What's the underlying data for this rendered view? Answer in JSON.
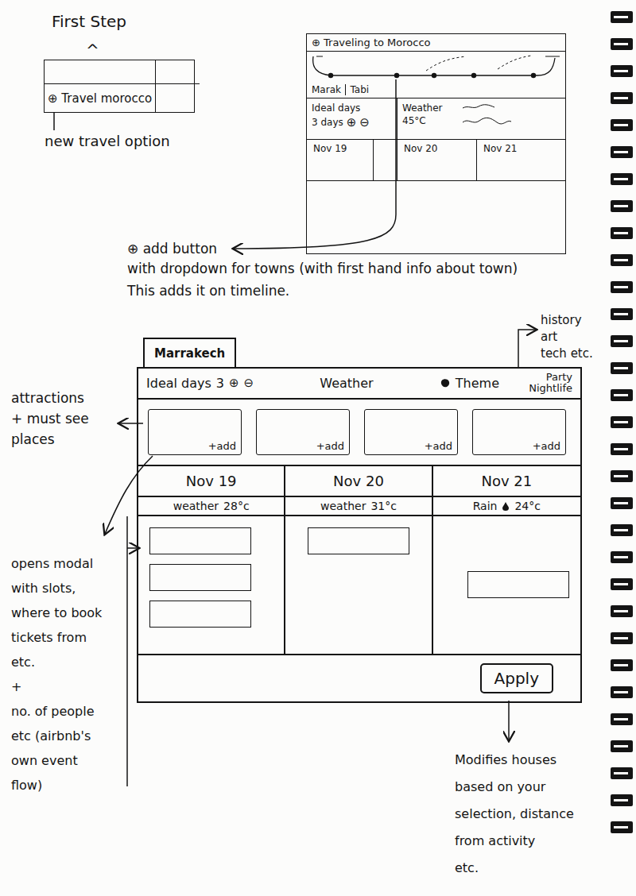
{
  "first_step": {
    "title": "First Step",
    "caret": "^",
    "option": "⊕ Travel morocco",
    "note": "new travel option"
  },
  "trip_overview": {
    "title": "⊕ Traveling to Morocco",
    "towns": [
      "Marak",
      "Tabi"
    ],
    "ideal_days": {
      "label": "Ideal days",
      "value": "3 days",
      "controls": [
        "⊕",
        "⊖"
      ]
    },
    "weather": {
      "label": "Weather",
      "value": "45°C"
    },
    "dates": [
      "Nov 19",
      "Nov 20",
      "Nov 21"
    ]
  },
  "add_button_note": {
    "title": "⊕ add button",
    "lines": [
      "with dropdown for towns (with first hand info about town)",
      "This adds it on timeline."
    ]
  },
  "town_planner": {
    "tabs": [
      {
        "label": "Marrakech",
        "selected": true
      }
    ],
    "ideal_days": {
      "label": "Ideal days",
      "value": "3",
      "controls": [
        "⊕",
        "⊖"
      ]
    },
    "weather_label": "Weather",
    "theme_label": "Theme",
    "theme_value": "Party Nightlife",
    "attractions": [
      {
        "add": "+add"
      },
      {
        "add": "+add"
      },
      {
        "add": "+add"
      },
      {
        "add": "+add"
      }
    ],
    "days": [
      {
        "date": "Nov 19",
        "weather": "weather",
        "temp": "28°c",
        "rain": false,
        "slots": 3
      },
      {
        "date": "Nov 20",
        "weather": "weather",
        "temp": "31°c",
        "rain": false,
        "slots": 1
      },
      {
        "date": "Nov 21",
        "weather": "Rain",
        "temp": "24°c",
        "rain": true,
        "slots": 1
      }
    ],
    "apply": "Apply"
  },
  "notes": {
    "theme_options": [
      "history",
      "art",
      "tech etc."
    ],
    "attractions": [
      "attractions",
      "+ must see",
      "places"
    ],
    "modal": [
      "opens modal",
      "with slots,",
      "where to book",
      "tickets from",
      "etc.",
      "+",
      "no. of people",
      "etc (airbnb's",
      "own event",
      "flow)"
    ],
    "apply": [
      "Modifies houses",
      "based on your",
      "selection, distance",
      "from activity",
      "etc."
    ]
  }
}
